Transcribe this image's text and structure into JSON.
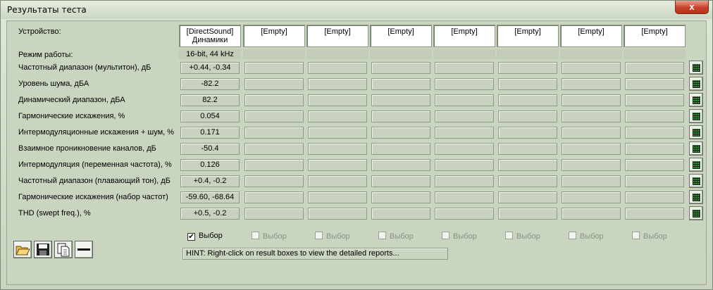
{
  "window": {
    "title": "Результаты теста",
    "close_label": "x"
  },
  "device_label": "Устройство:",
  "mode_label": "Режим работы:",
  "devices": [
    {
      "line1": "[DirectSound]",
      "line2": "Динамики",
      "mode": "16-bit, 44 kHz",
      "select_label": "Выбор",
      "selected": true,
      "enabled": true
    },
    {
      "line1": "[Empty]",
      "line2": "",
      "mode": "",
      "select_label": "Выбор",
      "selected": false,
      "enabled": false
    },
    {
      "line1": "[Empty]",
      "line2": "",
      "mode": "",
      "select_label": "Выбор",
      "selected": false,
      "enabled": false
    },
    {
      "line1": "[Empty]",
      "line2": "",
      "mode": "",
      "select_label": "Выбор",
      "selected": false,
      "enabled": false
    },
    {
      "line1": "[Empty]",
      "line2": "",
      "mode": "",
      "select_label": "Выбор",
      "selected": false,
      "enabled": false
    },
    {
      "line1": "[Empty]",
      "line2": "",
      "mode": "",
      "select_label": "Выбор",
      "selected": false,
      "enabled": false
    },
    {
      "line1": "[Empty]",
      "line2": "",
      "mode": "",
      "select_label": "Выбор",
      "selected": false,
      "enabled": false
    },
    {
      "line1": "[Empty]",
      "line2": "",
      "mode": "",
      "select_label": "Выбор",
      "selected": false,
      "enabled": false
    }
  ],
  "rows": [
    {
      "label": "Частотный диапазон (мультитон), дБ",
      "values": [
        "+0.44, -0.34",
        "",
        "",
        "",
        "",
        "",
        "",
        ""
      ]
    },
    {
      "label": "Уровень шума, дБА",
      "values": [
        "-82.2",
        "",
        "",
        "",
        "",
        "",
        "",
        ""
      ]
    },
    {
      "label": "Динамический диапазон, дБА",
      "values": [
        "82.2",
        "",
        "",
        "",
        "",
        "",
        "",
        ""
      ]
    },
    {
      "label": "Гармонические искажения, %",
      "values": [
        "0.054",
        "",
        "",
        "",
        "",
        "",
        "",
        ""
      ]
    },
    {
      "label": "Интермодуляционные искажения + шум, %",
      "values": [
        "0.171",
        "",
        "",
        "",
        "",
        "",
        "",
        ""
      ]
    },
    {
      "label": "Взаимное проникновение каналов, дБ",
      "values": [
        "-50.4",
        "",
        "",
        "",
        "",
        "",
        "",
        ""
      ]
    },
    {
      "label": "Интермодуляция (переменная частота), %",
      "values": [
        "0.126",
        "",
        "",
        "",
        "",
        "",
        "",
        ""
      ]
    },
    {
      "label": "Частотный диапазон (плавающий тон), дБ",
      "values": [
        "+0.4, -0.2",
        "",
        "",
        "",
        "",
        "",
        "",
        ""
      ]
    },
    {
      "label": "Гармонические искажения (набор частот)",
      "values": [
        "-59.60, -68.64",
        "",
        "",
        "",
        "",
        "",
        "",
        ""
      ]
    },
    {
      "label": "THD (swept freq.), %",
      "values": [
        "+0.5, -0.2",
        "",
        "",
        "",
        "",
        "",
        "",
        ""
      ]
    }
  ],
  "toolbar": [
    "open-folder-icon",
    "save-disk-icon",
    "copy-document-icon",
    "minus-line-icon"
  ],
  "hint": "HINT: Right-click on result boxes to view the detailed reports..."
}
